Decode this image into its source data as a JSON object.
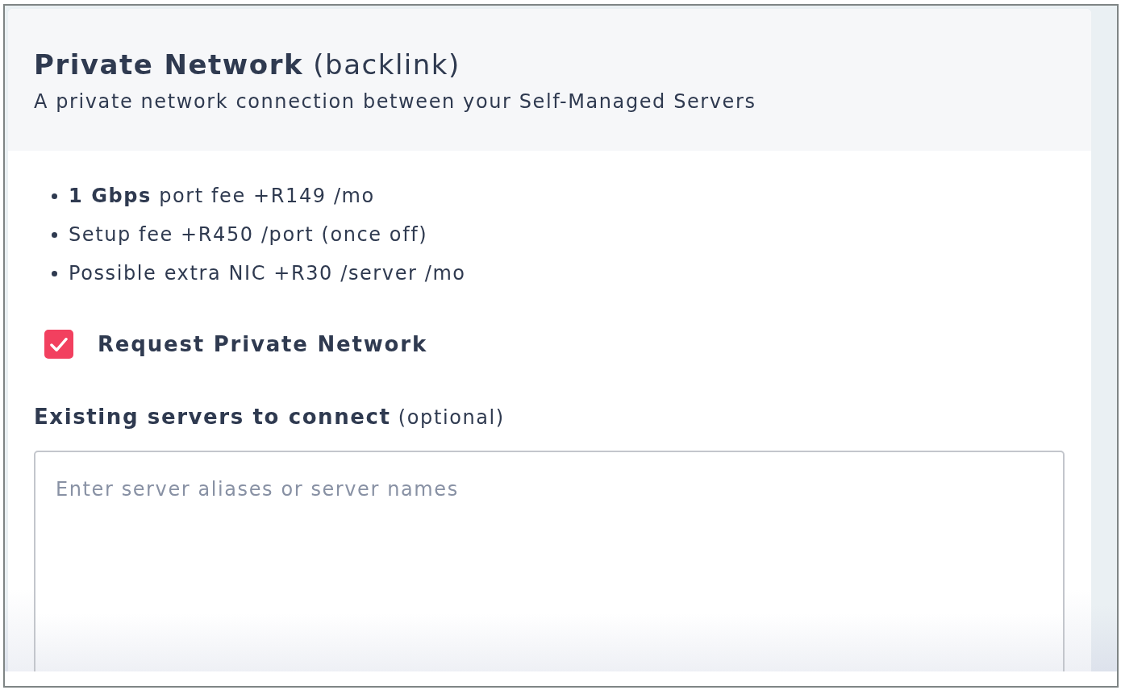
{
  "card": {
    "title": "**Private Network** (backlink)",
    "subtitle": "A private network connection between your Self-Managed Servers"
  },
  "features": [
    "**1 Gbps** port fee +R149 /mo",
    "Setup fee +R450 /port (once off)",
    "Possible extra NIC +R30 /server /mo"
  ],
  "request_checkbox": {
    "label": "Request Private Network",
    "checked": true
  },
  "servers_field": {
    "label": "**Existing servers to connect** (optional)",
    "placeholder": "Enter server aliases or server names"
  }
}
